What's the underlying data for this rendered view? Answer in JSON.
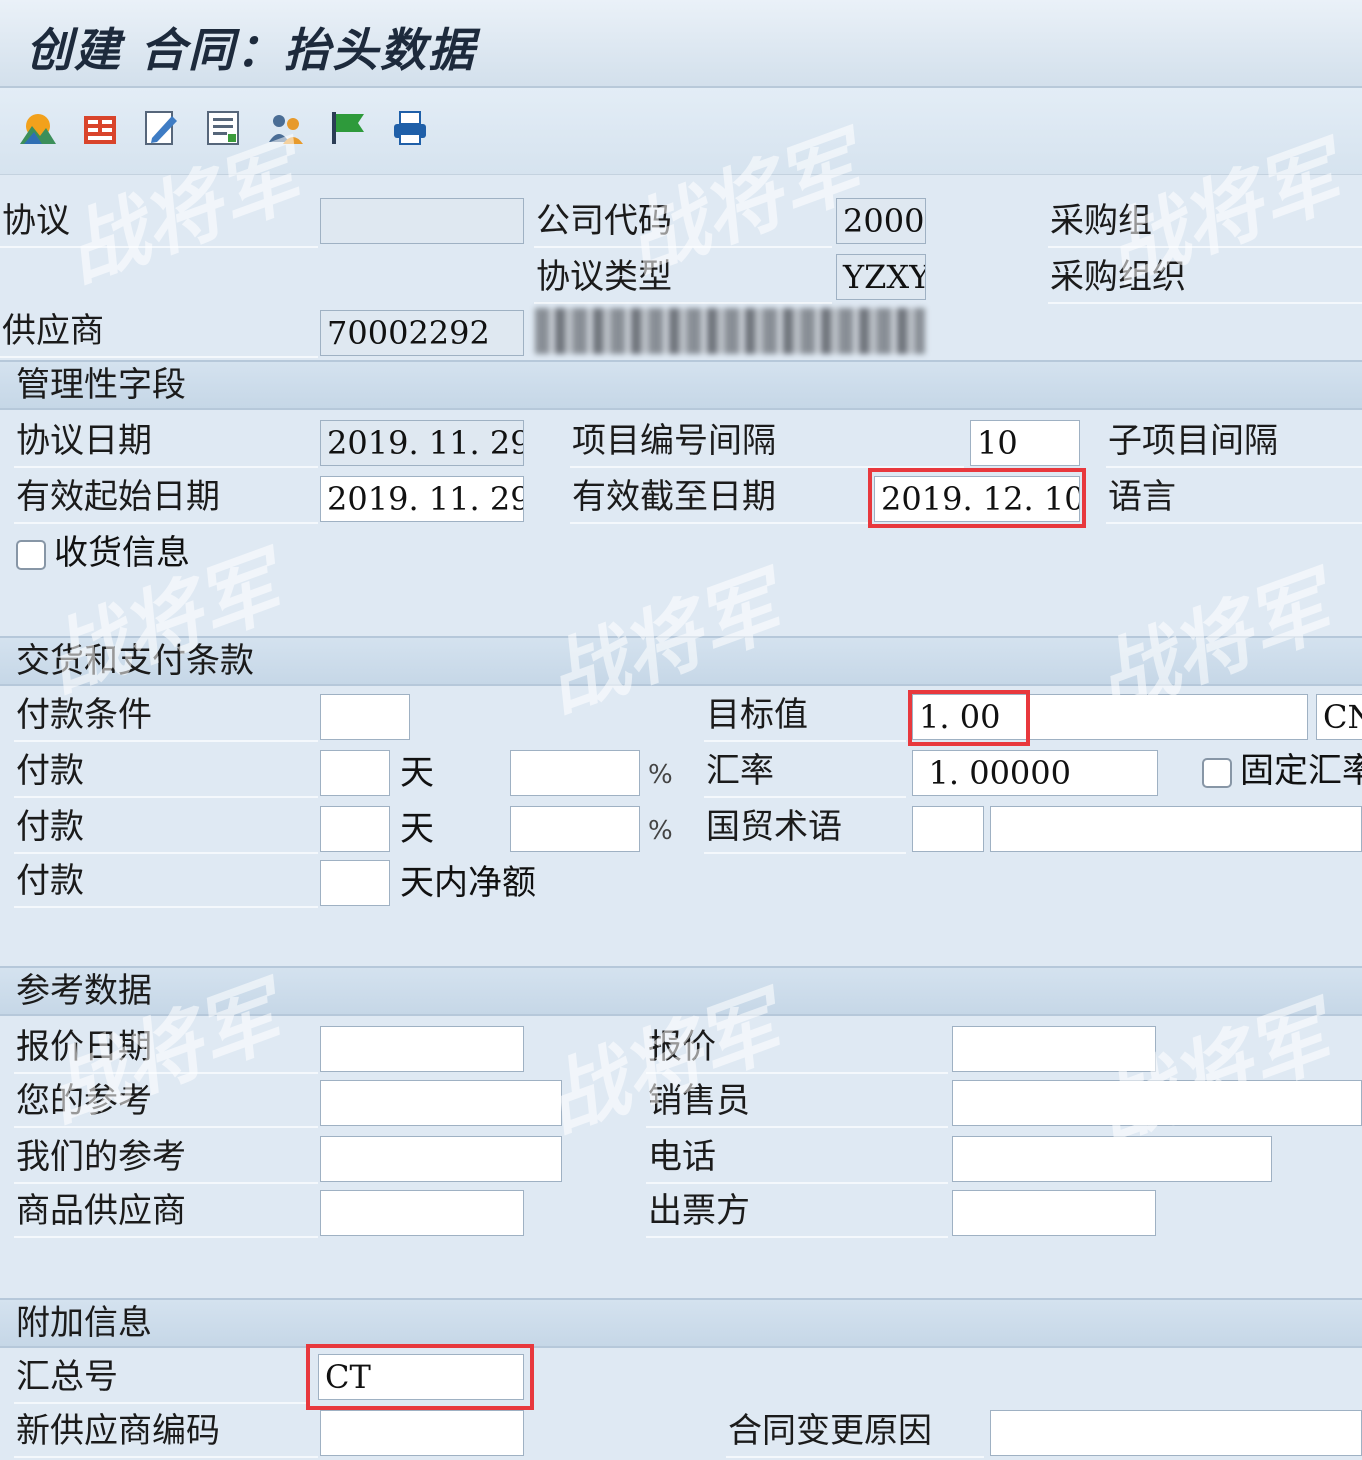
{
  "window": {
    "title": "创建 合同：抬头数据"
  },
  "toolbar": {
    "icons": [
      "header-overview-icon",
      "conditions-icon",
      "texts-icon",
      "address-icon",
      "partners-icon",
      "status-flag-icon",
      "print-icon"
    ]
  },
  "header": {
    "agreement_label": "协议",
    "agreement_value": "",
    "company_code_label": "公司代码",
    "company_code_value": "2000",
    "agreement_type_label": "协议类型",
    "agreement_type_value": "YZXY",
    "purch_group_label": "采购组",
    "purch_org_label": "采购组织",
    "vendor_label": "供应商",
    "vendor_value": "70002292"
  },
  "admin": {
    "section_title": "管理性字段",
    "agreement_date_label": "协议日期",
    "agreement_date_value": "2019. 11. 29",
    "item_interval_label": "项目编号间隔",
    "item_interval_value": "10",
    "subitem_interval_label": "子项目间隔",
    "valid_from_label": "有效起始日期",
    "valid_from_value": "2019. 11. 29",
    "valid_to_label": "有效截至日期",
    "valid_to_value": "2019. 12. 10",
    "language_label": "语言",
    "gr_message_label": "收货信息"
  },
  "delivery": {
    "section_title": "交货和支付条款",
    "payment_terms_label": "付款条件",
    "payment_label": "付款",
    "days_label": "天",
    "percent_label": "%",
    "days_net_label": "天内净额",
    "target_value_label": "目标值",
    "target_value_value": "1. 00",
    "currency_value": "CN",
    "exchange_rate_label": "汇率",
    "exchange_rate_value": "1. 00000",
    "fixed_rate_label": "固定汇率",
    "incoterms_label": "国贸术语"
  },
  "reference": {
    "section_title": "参考数据",
    "quotation_date_label": "报价日期",
    "quotation_label": "报价",
    "your_reference_label": "您的参考",
    "salesperson_label": "销售员",
    "our_reference_label": "我们的参考",
    "telephone_label": "电话",
    "supplying_vendor_label": "商品供应商",
    "invoicing_party_label": "出票方"
  },
  "additional": {
    "section_title": "附加信息",
    "collective_no_label": "汇总号",
    "collective_no_value": "CT",
    "new_vendor_code_label": "新供应商编码",
    "change_reason_label": "合同变更原因"
  },
  "watermark": {
    "text": "战将军"
  }
}
